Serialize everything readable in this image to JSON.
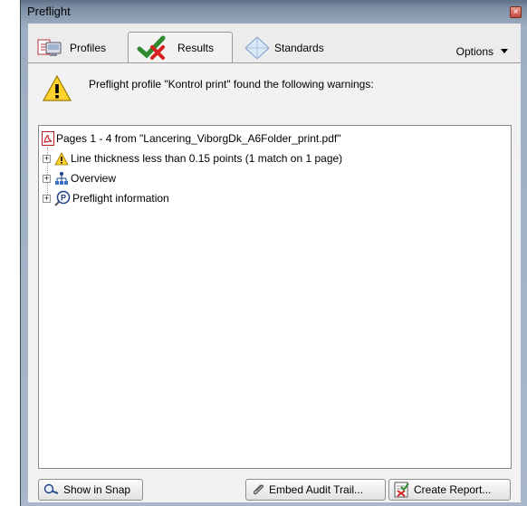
{
  "window": {
    "title": "Preflight",
    "close_glyph": "×"
  },
  "tabs": [
    {
      "label": "Profiles",
      "icon": "profiles-icon"
    },
    {
      "label": "Results",
      "icon": "results-check-icon"
    },
    {
      "label": "Standards",
      "icon": "standards-diamond-icon"
    }
  ],
  "options": {
    "label": "Options",
    "icon": "dropdown-arrow-icon"
  },
  "banner": {
    "text": "Preflight profile \"Kontrol print\" found the following warnings:",
    "icon": "warning-icon"
  },
  "tree": {
    "root": {
      "label": "Pages 1 - 4 from \"Lancering_ViborgDk_A6Folder_print.pdf\"",
      "icon": "pdf-icon"
    },
    "items": [
      {
        "label": "Line thickness less than 0.15 points (1 match on 1 page)",
        "icon": "warning-icon",
        "expander": "+"
      },
      {
        "label": "Overview",
        "icon": "overview-hierarchy-icon",
        "expander": "+"
      },
      {
        "label": "Preflight information",
        "icon": "preflight-info-icon",
        "expander": "+"
      }
    ]
  },
  "buttons": {
    "show_in_snap": "Show in Snap",
    "embed_audit_trail": "Embed Audit Trail...",
    "create_report": "Create Report..."
  }
}
